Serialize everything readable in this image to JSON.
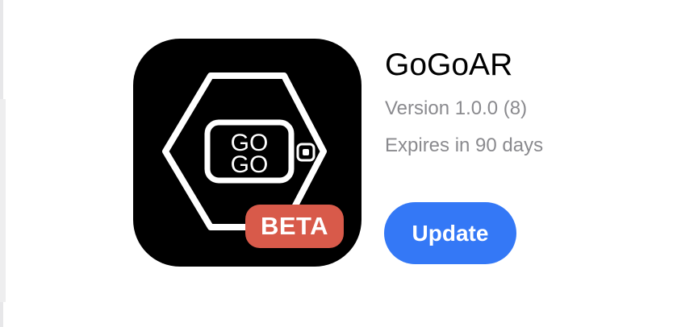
{
  "app": {
    "name": "GoGoAR",
    "version": "Version 1.0.0 (8)",
    "expiration": "Expires in 90 days",
    "icon": {
      "logo_line1": "GO",
      "logo_line2": "GO",
      "badge": "BETA",
      "badge_color": "#d85a4a",
      "background_color": "#000000"
    }
  },
  "actions": {
    "update_label": "Update",
    "accent_color": "#3478f6"
  }
}
